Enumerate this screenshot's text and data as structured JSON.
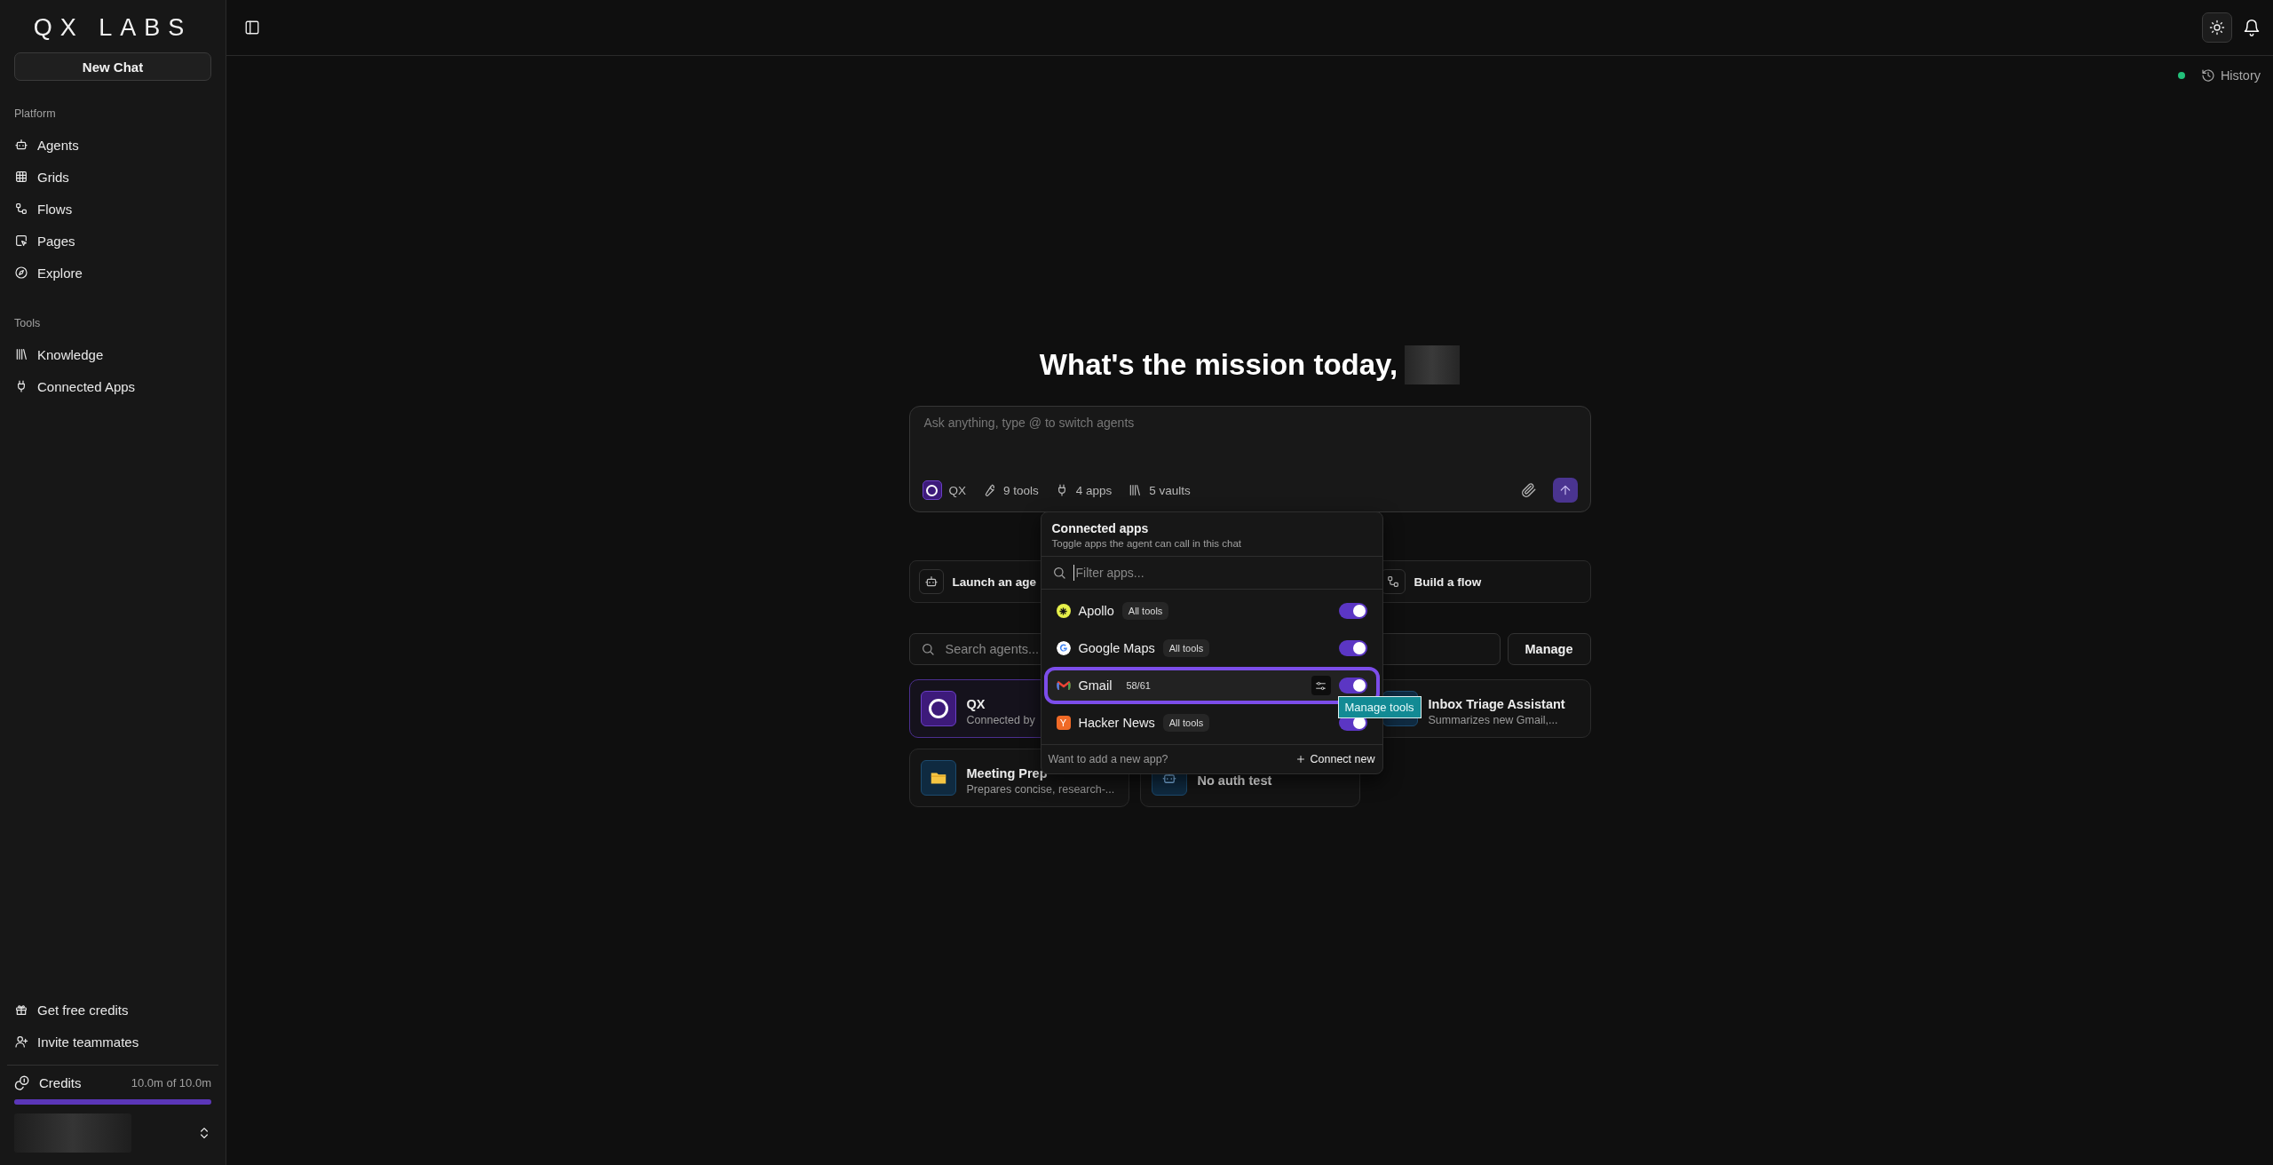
{
  "logo": "QX LABS",
  "sidebar": {
    "new_chat": "New Chat",
    "sections": [
      {
        "title": "Platform",
        "items": [
          {
            "label": "Agents"
          },
          {
            "label": "Grids"
          },
          {
            "label": "Flows"
          },
          {
            "label": "Pages"
          },
          {
            "label": "Explore"
          }
        ]
      },
      {
        "title": "Tools",
        "items": [
          {
            "label": "Knowledge"
          },
          {
            "label": "Connected Apps"
          }
        ]
      }
    ],
    "footer_items": [
      {
        "label": "Get free credits"
      },
      {
        "label": "Invite teammates"
      }
    ],
    "credits": {
      "label": "Credits",
      "reading": "10.0m of 10.0m",
      "level": 1
    }
  },
  "topbar": {
    "history": "History"
  },
  "heading": "What's the mission today,",
  "composer": {
    "placeholder": "Ask anything, type @ to switch agents",
    "agent": "QX",
    "chips": [
      {
        "label": "9 tools"
      },
      {
        "label": "4 apps"
      },
      {
        "label": "5 vaults"
      }
    ]
  },
  "apps_popup": {
    "title": "Connected apps",
    "subtitle": "Toggle apps the agent can call in this chat",
    "filter_placeholder": "Filter apps...",
    "apps": [
      {
        "name": "Apollo",
        "badge": "All tools",
        "on": true,
        "selected": false
      },
      {
        "name": "Google Maps",
        "badge": "All tools",
        "on": true,
        "selected": false
      },
      {
        "name": "Gmail",
        "badge": "58/61",
        "on": true,
        "selected": true
      },
      {
        "name": "Hacker News",
        "icon_text": "Y",
        "badge": "All tools",
        "on": true,
        "selected": false
      }
    ],
    "footer_text": "Want to add a new app?",
    "connect": "Connect new",
    "tooltip": "Manage tools"
  },
  "quick_actions": [
    {
      "label": "Launch an age"
    },
    {
      "label": "Build a flow"
    }
  ],
  "agent_search": {
    "placeholder": "Search agents...",
    "manage": "Manage"
  },
  "agents": [
    {
      "name": "QX",
      "description": "Connected by",
      "selected": true
    },
    {
      "name": "Inbox Triage Assistant",
      "description": "Summarizes new Gmail,...",
      "selected": false
    },
    {
      "name": "Meeting Prep",
      "description": "Prepares concise, research-...",
      "selected": false
    },
    {
      "name": "No auth test",
      "selected": false
    }
  ]
}
